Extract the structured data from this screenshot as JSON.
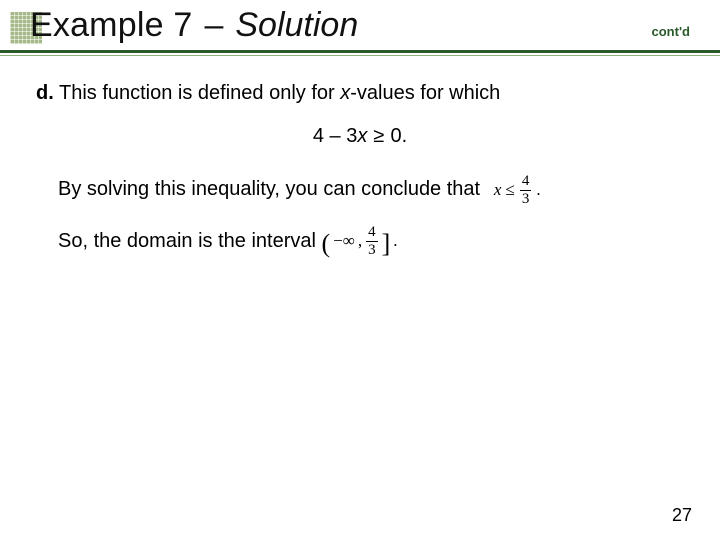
{
  "header": {
    "title_prefix": "Example 7",
    "title_dash": "–",
    "title_suffix": "Solution",
    "contd": "cont'd"
  },
  "body": {
    "part_label": "d.",
    "intro_text_1": " This function is defined only for ",
    "intro_var": "x",
    "intro_text_2": "-values for which",
    "inequality": {
      "lhs_a": "4 – 3",
      "lhs_var": "x",
      "rel_char": "≥",
      "rhs": "0.",
      "full_plain": "4 – 3x ≥ 0."
    },
    "conclude_text": "By solving this inequality, you can conclude that",
    "conclude_math": {
      "var": "x",
      "rel": "≤",
      "frac_num": "4",
      "frac_den": "3",
      "tail": ".",
      "plain": "x ≤ 4/3."
    },
    "domain_text": "So, the domain is the interval",
    "interval": {
      "open": "(",
      "neg_inf": "−∞",
      "comma": ",",
      "frac_num": "4",
      "frac_den": "3",
      "close": "]",
      "tail": ".",
      "plain": "(−∞, 4/3]."
    }
  },
  "page_number": "27"
}
